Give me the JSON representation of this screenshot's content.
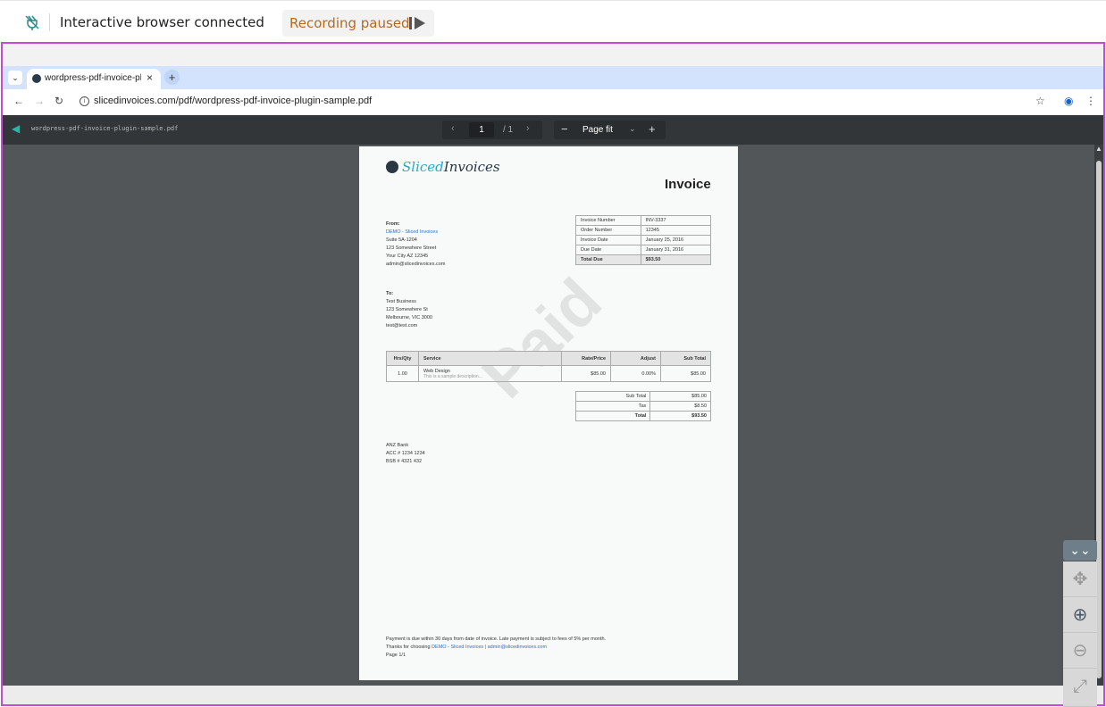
{
  "status": {
    "connection_text": "Interactive browser connected",
    "recording_text": "Recording paused"
  },
  "browser": {
    "tab_title": "wordpress-pdf-invoice-pl",
    "url": "slicedinvoices.com/pdf/wordpress-pdf-invoice-plugin-sample.pdf"
  },
  "pdf_viewer": {
    "file_name": "wordpress-pdf-invoice-plugin-sample.pdf",
    "page_input": "1",
    "page_total": "/ 1",
    "zoom_label": "Page fit"
  },
  "invoice": {
    "logo_part1": "Sliced",
    "logo_part2": "Invoices",
    "title": "Invoice",
    "from_label": "From:",
    "from_company": "DEMO - Sliced Invoices",
    "from_address1": "Suite 5A-1204",
    "from_address2": "123 Somewhere Street",
    "from_address3": "Your City AZ 12345",
    "from_email": "admin@slicedinvoices.com",
    "meta": [
      {
        "label": "Invoice Number",
        "value": "INV-3337"
      },
      {
        "label": "Order Number",
        "value": "12345"
      },
      {
        "label": "Invoice Date",
        "value": "January 25, 2016"
      },
      {
        "label": "Due Date",
        "value": "January 31, 2016"
      },
      {
        "label": "Total Due",
        "value": "$93.50"
      }
    ],
    "to_label": "To:",
    "to_name": "Test Business",
    "to_address1": "123 Somewhere St",
    "to_address2": "Melbourne, VIC 3000",
    "to_email": "test@test.com",
    "items_headers": [
      "Hrs/Qty",
      "Service",
      "Rate/Price",
      "Adjust",
      "Sub Total"
    ],
    "item": {
      "qty": "1.00",
      "service": "Web Design",
      "description": "This is a sample description...",
      "rate": "$85.00",
      "adjust": "0.00%",
      "subtotal": "$85.00"
    },
    "totals": [
      {
        "label": "Sub Total",
        "value": "$85.00"
      },
      {
        "label": "Tax",
        "value": "$8.50"
      },
      {
        "label": "Total",
        "value": "$93.50"
      }
    ],
    "bank_name": "ANZ Bank",
    "bank_acc": "ACC # 1234 1234",
    "bank_bsb": "BSB # 4321 432",
    "footer_line1": "Payment is due within 30 days from date of invoice. Late payment is subject to fees of 5% per month.",
    "footer_thanks": "Thanks for choosing",
    "footer_link": "DEMO - Sliced Invoices | admin@slicedinvoices.com",
    "footer_page": "Page 1/1",
    "watermark": "Paid"
  }
}
